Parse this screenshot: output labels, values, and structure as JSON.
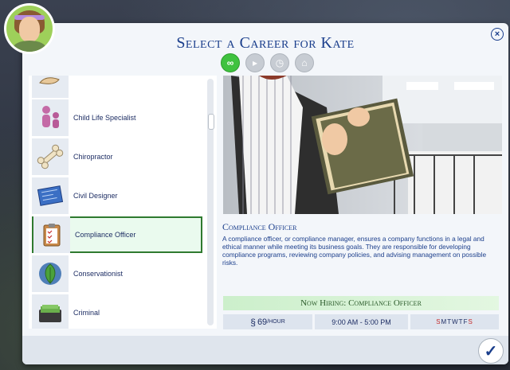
{
  "dialog": {
    "title": "Select a Career for Kate",
    "close_icon": "close-icon",
    "confirm_icon": "checkmark-icon"
  },
  "filters": [
    {
      "name": "infinity-filter",
      "symbol": "∞",
      "active": true
    },
    {
      "name": "part-time-filter",
      "symbol": "▸",
      "active": false
    },
    {
      "name": "schedule-filter",
      "symbol": "◷",
      "active": false
    },
    {
      "name": "work-from-home-filter",
      "symbol": "⌂",
      "active": false
    }
  ],
  "careers": [
    {
      "label": "",
      "icon": "partial-icon"
    },
    {
      "label": "Child Life Specialist",
      "icon": "parent-child-icon"
    },
    {
      "label": "Chiropractor",
      "icon": "bone-icon"
    },
    {
      "label": "Civil Designer",
      "icon": "blueprint-icon"
    },
    {
      "label": "Compliance Officer",
      "icon": "clipboard-icon",
      "selected": true
    },
    {
      "label": "Conservationist",
      "icon": "leaf-globe-icon"
    },
    {
      "label": "Criminal",
      "icon": "cash-briefcase-icon"
    }
  ],
  "selected": {
    "name": "Compliance Officer",
    "description": "A compliance officer, or compliance manager, ensures a company functions in a legal and ethical manner while meeting its business goals. They are responsible for developing compliance programs, reviewing company policies, and advising management on possible risks.",
    "hiring": "Now Hiring: Compliance Officer",
    "pay_symbol": "§",
    "pay_value": "69",
    "pay_unit": "/HOUR",
    "hours": "9:00 AM - 5:00 PM",
    "days": [
      {
        "letter": "S",
        "off": true
      },
      {
        "letter": "M",
        "off": false
      },
      {
        "letter": "T",
        "off": false
      },
      {
        "letter": "W",
        "off": false
      },
      {
        "letter": "T",
        "off": false
      },
      {
        "letter": "F",
        "off": false
      },
      {
        "letter": "S",
        "off": true
      }
    ]
  },
  "colors": {
    "title_blue": "#1a3e8c",
    "active_filter": "#3fc23f",
    "selected_border": "#2f7a2f",
    "day_off_red": "#c42b2b"
  }
}
